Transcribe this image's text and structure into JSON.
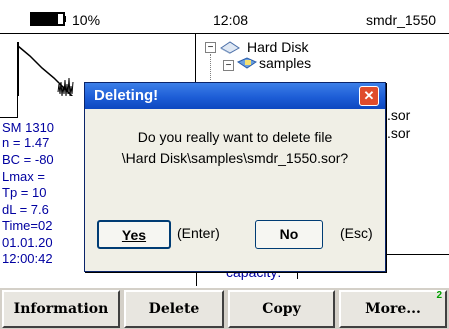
{
  "status_bar": {
    "battery": "10%",
    "time": "12:08",
    "file": "smdr_1550"
  },
  "tree": {
    "root": "Hard Disk",
    "child": "samples",
    "files": [
      ".sor",
      ".sor"
    ]
  },
  "params": {
    "lines": [
      "SM 1310",
      "n = 1.47",
      "BC = -80",
      "Lmax =",
      "Tp = 10",
      "dL = 7.6",
      "Time=02",
      "01.01.20",
      "12:00:42"
    ]
  },
  "capacity": {
    "label": "capacity:"
  },
  "toolbar": {
    "information": "Information",
    "delete": "Delete",
    "copy": "Copy",
    "more": "More...",
    "more_badge": "2"
  },
  "dialog": {
    "title": "Deleting!",
    "close": "✕",
    "message_line1": "Do you really want to delete file",
    "message_line2": "\\Hard Disk\\samples\\smdr_1550.sor?",
    "yes": "Yes",
    "yes_hint": "(Enter)",
    "no": "No",
    "no_hint": "(Esc)"
  }
}
